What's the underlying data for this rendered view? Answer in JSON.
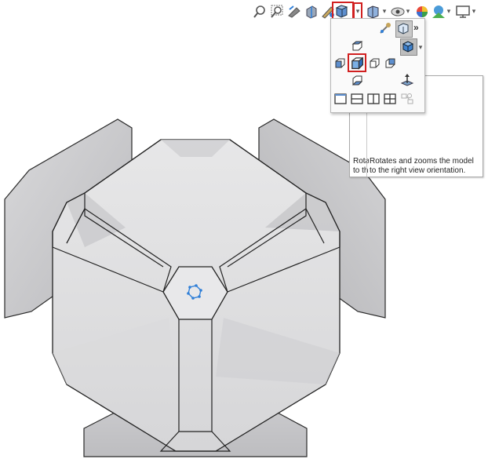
{
  "toolbar": {
    "icons": [
      "zoom-to-fit-icon",
      "zoom-to-area-icon",
      "previous-view-icon",
      "section-view-icon",
      "dynamic-annotation-icon",
      "view-orientation-icon",
      "display-style-icon",
      "hide-show-items-icon",
      "edit-appearance-icon",
      "apply-scene-icon",
      "view-settings-icon"
    ]
  },
  "flyout": {
    "more_label": "»"
  },
  "tooltip": {
    "back_text": "Rota\nto th",
    "description": "Rotates and zooms the model to the right view orientation."
  },
  "colors": {
    "selection_outline": "#d12020",
    "accent_blue": "#2f7fd8",
    "model_edge": "#222222"
  }
}
